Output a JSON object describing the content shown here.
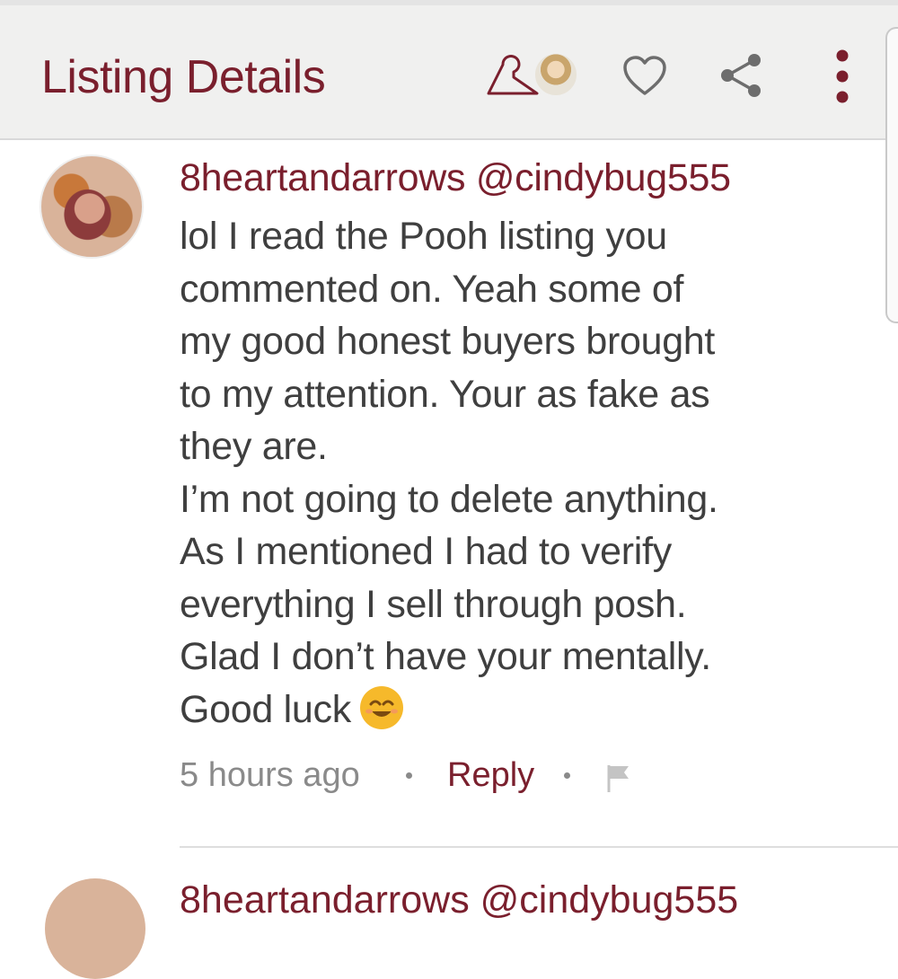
{
  "header": {
    "title": "Listing Details",
    "icons": [
      "hanger-icon",
      "seller-avatar",
      "heart-icon",
      "share-icon",
      "more-vert-icon"
    ]
  },
  "colors": {
    "brand": "#7a1f2d",
    "text": "#3f3f3f",
    "muted": "#8a8a8a",
    "header_bg": "#f0f0ef"
  },
  "comment": {
    "author": "8heartandarrows @cindybug555",
    "lines": [
      "lol I read the Pooh listing you",
      "commented on. Yeah some of",
      "my good honest buyers brought",
      "to my attention. Your as fake as",
      "they are.",
      "I’m not going to delete anything.",
      "As I mentioned I had to verify",
      "everything I sell through posh.",
      "Glad I don’t have your mentally.",
      "Good luck"
    ],
    "emoji": "smiling-face-icon",
    "time": "5 hours ago",
    "reply_label": "Reply"
  },
  "next_comment": {
    "author": "8heartandarrows @cindybug555"
  }
}
